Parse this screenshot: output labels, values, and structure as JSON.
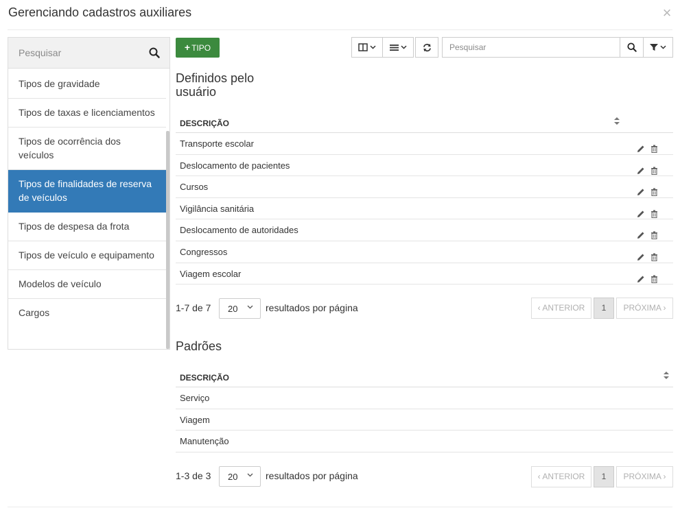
{
  "modal": {
    "title": "Gerenciando cadastros auxiliares",
    "close_icon": "close-icon",
    "close_glyph": "×"
  },
  "sidebar": {
    "search_placeholder": "Pesquisar",
    "items": [
      {
        "label": "Tipos de gravidade"
      },
      {
        "label": "Tipos de taxas e licenciamentos"
      },
      {
        "label": "Tipos de ocorrência dos veículos"
      },
      {
        "label": "Tipos de finalidades de reserva de veículos",
        "active": true
      },
      {
        "label": "Tipos de despesa da frota"
      },
      {
        "label": "Tipos de veículo e equipamento"
      },
      {
        "label": "Modelos de veículo"
      },
      {
        "label": "Cargos"
      }
    ]
  },
  "toolbar": {
    "add_label": "TIPO",
    "add_glyph": "+",
    "search_placeholder": "Pesquisar",
    "accent_color": "#3c8a3e"
  },
  "user_defined": {
    "title": "Definidos pelo usuário",
    "column_header": "DESCRIÇÃO",
    "rows": [
      "Transporte escolar",
      "Deslocamento de pacientes",
      "Cursos",
      "Vigilância sanitária",
      "Deslocamento de autoridades",
      "Congressos",
      "Viagem escolar"
    ],
    "range_text": "1-7 de 7"
  },
  "defaults": {
    "title": "Padrões",
    "column_header": "DESCRIÇÃO",
    "rows": [
      "Serviço",
      "Viagem",
      "Manutenção"
    ],
    "range_text": "1-3 de 3"
  },
  "pagination": {
    "page_size": "20",
    "per_page_label": "resultados por página",
    "prev_label": "ANTERIOR",
    "next_label": "PRÓXIMA",
    "current_page": "1"
  },
  "colors": {
    "active_item": "#337ab7"
  }
}
